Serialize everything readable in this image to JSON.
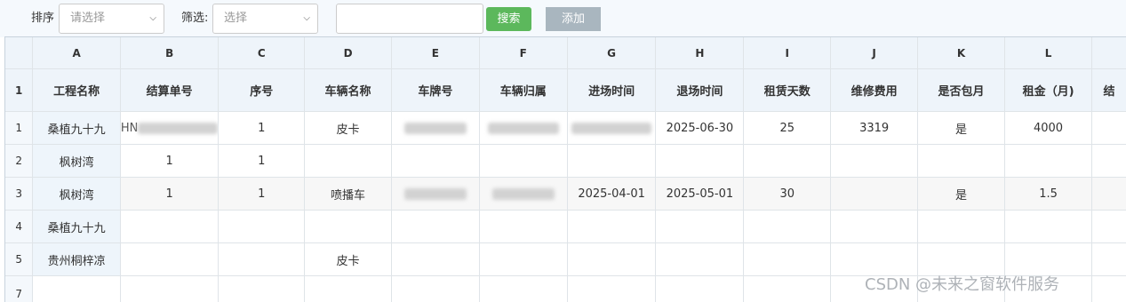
{
  "toolbar": {
    "sort_label": "排序",
    "sort_placeholder": "请选择",
    "filter_label": "筛选:",
    "filter_placeholder": "选择",
    "search_value": "",
    "search_button": "搜索",
    "add_button": "添加"
  },
  "grid": {
    "col_letters": [
      "A",
      "B",
      "C",
      "D",
      "E",
      "F",
      "G",
      "H",
      "I",
      "J",
      "K",
      "L"
    ],
    "fields": [
      "工程名称",
      "结算单号",
      "序号",
      "车辆名称",
      "车牌号",
      "车辆归属",
      "进场时间",
      "退场时间",
      "租赁天数",
      "维修费用",
      "是否包月",
      "租金（月)"
    ],
    "field_next_partial": "结",
    "header_row_number": "1",
    "rows": [
      {
        "num": "1",
        "project": "桑植九十九",
        "settle_no": "HN",
        "seq": "1",
        "vehicle": "皮卡",
        "plate": "",
        "owner": "",
        "enter": "",
        "exit": "2025-06-30",
        "days": "25",
        "repair": "3319",
        "monthly": "是",
        "rent": "4000"
      },
      {
        "num": "2",
        "project": "枫树湾",
        "settle_no": "1",
        "seq": "1",
        "vehicle": "",
        "plate": "",
        "owner": "",
        "enter": "",
        "exit": "",
        "days": "",
        "repair": "",
        "monthly": "",
        "rent": ""
      },
      {
        "num": "3",
        "project": "枫树湾",
        "settle_no": "1",
        "seq": "1",
        "vehicle": "喷播车",
        "plate": "",
        "owner": "",
        "enter": "2025-04-01",
        "exit": "2025-05-01",
        "days": "30",
        "repair": "",
        "monthly": "是",
        "rent": "1.5"
      },
      {
        "num": "4",
        "project": "桑植九十九",
        "settle_no": "",
        "seq": "",
        "vehicle": "",
        "plate": "",
        "owner": "",
        "enter": "",
        "exit": "",
        "days": "",
        "repair": "",
        "monthly": "",
        "rent": ""
      },
      {
        "num": "5",
        "project": "贵州桐梓凉",
        "settle_no": "",
        "seq": "",
        "vehicle": "皮卡",
        "plate": "",
        "owner": "",
        "enter": "",
        "exit": "",
        "days": "",
        "repair": "",
        "monthly": "",
        "rent": ""
      }
    ],
    "empty_row_number": "7"
  },
  "watermark": "CSDN @未来之窗软件服务"
}
